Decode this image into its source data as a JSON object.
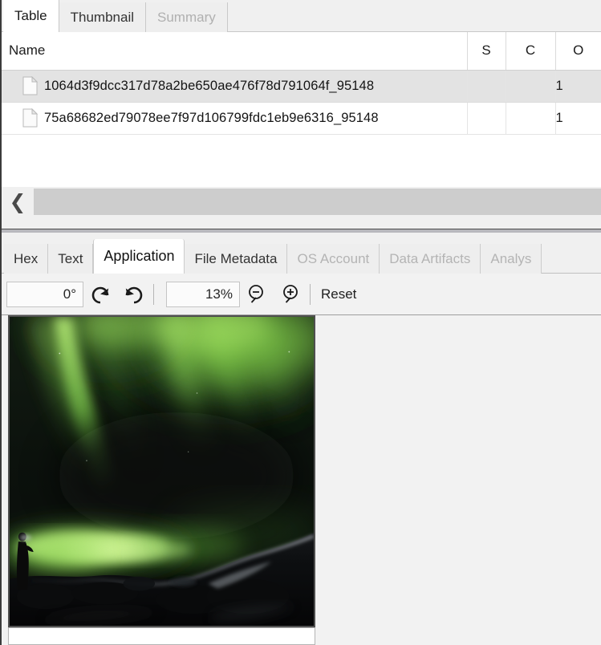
{
  "top_tabs": [
    {
      "label": "Table",
      "state": "selected"
    },
    {
      "label": "Thumbnail",
      "state": "normal"
    },
    {
      "label": "Summary",
      "state": "disabled"
    }
  ],
  "table": {
    "columns": [
      {
        "key": "name",
        "label": "Name"
      },
      {
        "key": "s",
        "label": "S"
      },
      {
        "key": "c",
        "label": "C"
      },
      {
        "key": "o",
        "label": "O"
      }
    ],
    "rows": [
      {
        "icon": "file-icon",
        "name": "1064d3f9dcc317d78a2be650ae476f78d791064f_95148",
        "s": "",
        "c": "",
        "o": "1",
        "selected": true
      },
      {
        "icon": "file-icon",
        "name": "75a68682ed79078ee7f97d106799fdc1eb9e6316_95148",
        "s": "",
        "c": "",
        "o": "1",
        "selected": false
      }
    ]
  },
  "horizontal_scrollbar": {
    "left_arrow_icon": "chevron-left-icon",
    "left_arrow_glyph": "❮"
  },
  "bottom_tabs": [
    {
      "label": "Hex",
      "state": "normal"
    },
    {
      "label": "Text",
      "state": "normal"
    },
    {
      "label": "Application",
      "state": "selected"
    },
    {
      "label": "File Metadata",
      "state": "normal"
    },
    {
      "label": "OS Account",
      "state": "disabled"
    },
    {
      "label": "Data Artifacts",
      "state": "disabled"
    },
    {
      "label": "Analys",
      "state": "disabled"
    }
  ],
  "viewer_toolbar": {
    "rotation_value": "0°",
    "rotate_left_icon": "rotate-counterclockwise-icon",
    "rotate_right_icon": "rotate-clockwise-icon",
    "zoom_value": "13%",
    "zoom_out_icon": "zoom-out-icon",
    "zoom_in_icon": "zoom-in-icon",
    "reset_label": "Reset"
  },
  "viewer": {
    "image_name": "aurora-borealis-photo",
    "image_description": "Night photograph of green aurora borealis over a dark rocky landscape with a person silhouette at left",
    "colors": {
      "aurora_green_bright": "#8fd94a",
      "aurora_green_mid": "#4f9a33",
      "sky_dark": "#0d1410",
      "ground_black": "#0a0a0a"
    }
  }
}
